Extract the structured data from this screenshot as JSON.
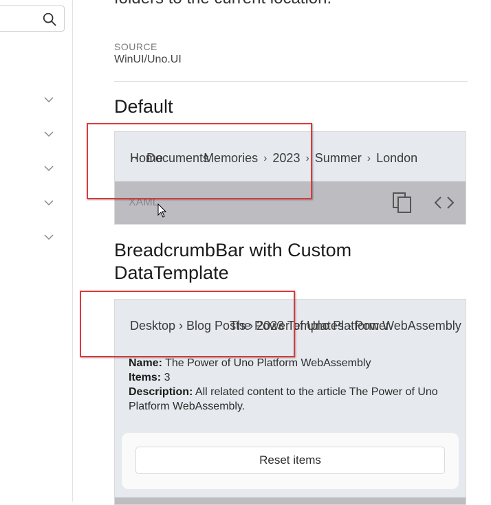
{
  "sidebar": {
    "search_icon": "search-icon",
    "chevrons": [
      "chevron-down-icon",
      "chevron-down-icon",
      "chevron-down-icon",
      "chevron-down-icon",
      "chevron-down-icon"
    ]
  },
  "main": {
    "intro_text": "folders to the current location.",
    "source_caption": "SOURCE",
    "source_value": "WinUI/Uno.UI",
    "section_default": {
      "title": "Default",
      "breadcrumbs": [
        "Home",
        "Documents",
        "Memories",
        "2023",
        "Summer",
        "London"
      ],
      "overlay_text": "··· ›",
      "separator": "›",
      "xaml_label": "XAML"
    },
    "section_custom": {
      "title_line1": "BreadcrumbBar with Custom",
      "title_line2": "DataTemplate",
      "breadcrumbs_overlap": "Desktop › Blog Posts › 2023 Templates › Power",
      "breadcrumbs_visible": "The Power of Uno Platform WebAssembly",
      "name_label": "Name:",
      "name_value": "The Power of Uno Platform WebAssembly",
      "items_label": "Items:",
      "items_value": "3",
      "description_label": "Description:",
      "description_value": "All related content to the article The Power of Uno Platform WebAssembly.",
      "reset_button": "Reset items"
    }
  },
  "colors": {
    "highlight": "#e0383b",
    "card_bg": "#e6e9ed",
    "xaml_bar": "#bdbcc0"
  }
}
